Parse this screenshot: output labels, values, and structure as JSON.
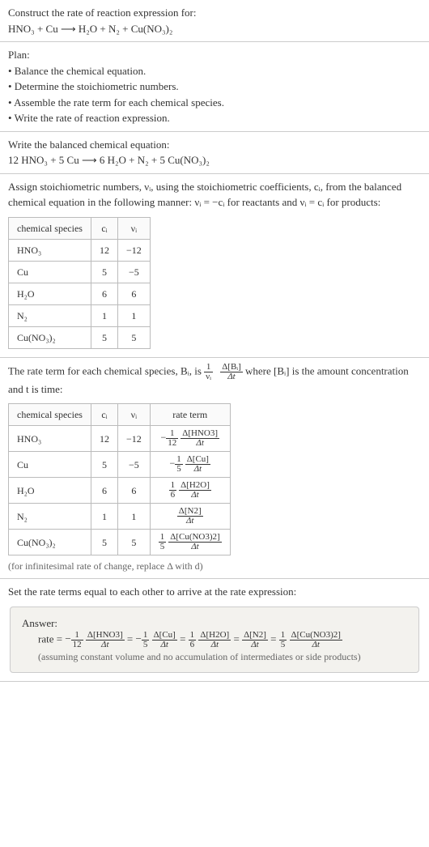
{
  "prompt": {
    "title": "Construct the rate of reaction expression for:",
    "equation": "HNO₃ + Cu ⟶ H₂O + N₂ + Cu(NO₃)₂"
  },
  "plan": {
    "heading": "Plan:",
    "items": [
      "• Balance the chemical equation.",
      "• Determine the stoichiometric numbers.",
      "• Assemble the rate term for each chemical species.",
      "• Write the rate of reaction expression."
    ]
  },
  "balanced": {
    "heading": "Write the balanced chemical equation:",
    "equation": "12 HNO₃ + 5 Cu ⟶ 6 H₂O + N₂ + 5 Cu(NO₃)₂"
  },
  "stoich": {
    "intro_a": "Assign stoichiometric numbers, νᵢ, using the stoichiometric coefficients, cᵢ, from the balanced chemical equation in the following manner: νᵢ = −cᵢ for reactants and νᵢ = cᵢ for products:",
    "headers": [
      "chemical species",
      "cᵢ",
      "νᵢ"
    ],
    "rows": [
      {
        "sp": "HNO₃",
        "c": "12",
        "v": "−12"
      },
      {
        "sp": "Cu",
        "c": "5",
        "v": "−5"
      },
      {
        "sp": "H₂O",
        "c": "6",
        "v": "6"
      },
      {
        "sp": "N₂",
        "c": "1",
        "v": "1"
      },
      {
        "sp": "Cu(NO₃)₂",
        "c": "5",
        "v": "5"
      }
    ]
  },
  "rate_terms": {
    "intro_a": "The rate term for each chemical species, Bᵢ, is ",
    "frac1_num": "1",
    "frac1_den": "νᵢ",
    "frac2_num": "Δ[Bᵢ]",
    "frac2_den": "Δt",
    "intro_b": " where [Bᵢ] is the amount concentration and t is time:",
    "headers": [
      "chemical species",
      "cᵢ",
      "νᵢ",
      "rate term"
    ],
    "rows": [
      {
        "sp": "HNO₃",
        "c": "12",
        "v": "−12",
        "sign": "−",
        "coef_num": "1",
        "coef_den": "12",
        "d_num": "Δ[HNO3]",
        "d_den": "Δt"
      },
      {
        "sp": "Cu",
        "c": "5",
        "v": "−5",
        "sign": "−",
        "coef_num": "1",
        "coef_den": "5",
        "d_num": "Δ[Cu]",
        "d_den": "Δt"
      },
      {
        "sp": "H₂O",
        "c": "6",
        "v": "6",
        "sign": "",
        "coef_num": "1",
        "coef_den": "6",
        "d_num": "Δ[H2O]",
        "d_den": "Δt"
      },
      {
        "sp": "N₂",
        "c": "1",
        "v": "1",
        "sign": "",
        "coef_num": "",
        "coef_den": "",
        "d_num": "Δ[N2]",
        "d_den": "Δt"
      },
      {
        "sp": "Cu(NO₃)₂",
        "c": "5",
        "v": "5",
        "sign": "",
        "coef_num": "1",
        "coef_den": "5",
        "d_num": "Δ[Cu(NO3)2]",
        "d_den": "Δt"
      }
    ],
    "note": "(for infinitesimal rate of change, replace Δ with d)"
  },
  "final": {
    "heading": "Set the rate terms equal to each other to arrive at the rate expression:",
    "answer_label": "Answer:",
    "rate_label": "rate = ",
    "terms": [
      {
        "sign": "−",
        "coef_num": "1",
        "coef_den": "12",
        "d_num": "Δ[HNO3]",
        "d_den": "Δt"
      },
      {
        "sign": "−",
        "coef_num": "1",
        "coef_den": "5",
        "d_num": "Δ[Cu]",
        "d_den": "Δt"
      },
      {
        "sign": "",
        "coef_num": "1",
        "coef_den": "6",
        "d_num": "Δ[H2O]",
        "d_den": "Δt"
      },
      {
        "sign": "",
        "coef_num": "",
        "coef_den": "",
        "d_num": "Δ[N2]",
        "d_den": "Δt"
      },
      {
        "sign": "",
        "coef_num": "1",
        "coef_den": "5",
        "d_num": "Δ[Cu(NO3)2]",
        "d_den": "Δt"
      }
    ],
    "assumption": "(assuming constant volume and no accumulation of intermediates or side products)"
  },
  "chart_data": {
    "type": "table",
    "reaction_unbalanced": "HNO3 + Cu -> H2O + N2 + Cu(NO3)2",
    "reaction_balanced": "12 HNO3 + 5 Cu -> 6 H2O + N2 + 5 Cu(NO3)2",
    "species": [
      "HNO3",
      "Cu",
      "H2O",
      "N2",
      "Cu(NO3)2"
    ],
    "c_i": [
      12,
      5,
      6,
      1,
      5
    ],
    "nu_i": [
      -12,
      -5,
      6,
      1,
      5
    ],
    "rate_expression": "rate = -(1/12) d[HNO3]/dt = -(1/5) d[Cu]/dt = (1/6) d[H2O]/dt = d[N2]/dt = (1/5) d[Cu(NO3)2]/dt"
  }
}
